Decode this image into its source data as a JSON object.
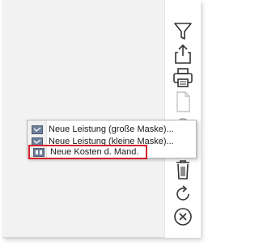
{
  "toolbar": {
    "icons": [
      "filter-icon",
      "share-icon",
      "print-icon",
      "document-icon",
      "info-icon",
      "trash-icon",
      "refresh-icon",
      "close-icon"
    ]
  },
  "menu": {
    "items": [
      {
        "label": "Neue Leistung (große Maske)...",
        "icon": "form-icon"
      },
      {
        "label": "Neue Leistung (kleine Maske)...",
        "icon": "form-icon"
      },
      {
        "label": "Neue Kosten d. Mand.",
        "icon": "cost-icon"
      }
    ],
    "highlight_color": "#d4202a"
  }
}
